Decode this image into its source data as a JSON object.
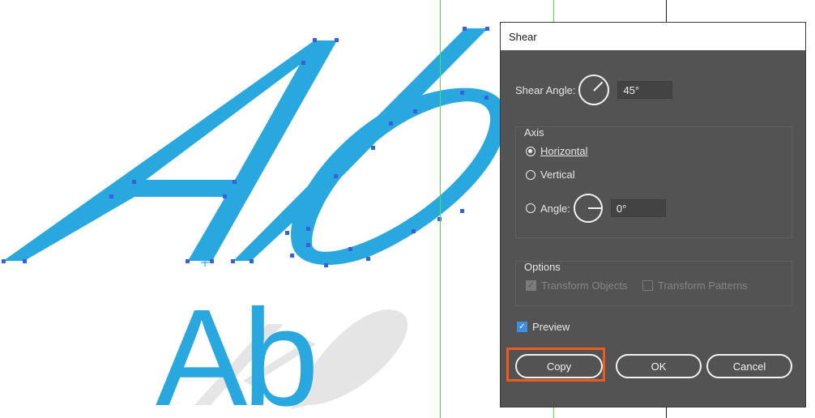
{
  "dialog": {
    "title": "Shear",
    "shear_angle_label": "Shear Angle:",
    "shear_angle_value": "45°",
    "axis": {
      "title": "Axis",
      "horizontal_label": "Horizontal",
      "vertical_label": "Vertical",
      "angle_label": "Angle:",
      "angle_value": "0°",
      "selected": "Horizontal"
    },
    "options": {
      "title": "Options",
      "transform_objects_label": "Transform Objects",
      "transform_objects_checked": true,
      "transform_patterns_label": "Transform Patterns",
      "transform_patterns_checked": false
    },
    "preview_label": "Preview",
    "preview_checked": true,
    "buttons": {
      "copy": "Copy",
      "ok": "OK",
      "cancel": "Cancel"
    }
  },
  "artwork": {
    "original_text": "Ab",
    "accent_color": "#29a8e0",
    "highlight_color": "#f05a1e"
  }
}
